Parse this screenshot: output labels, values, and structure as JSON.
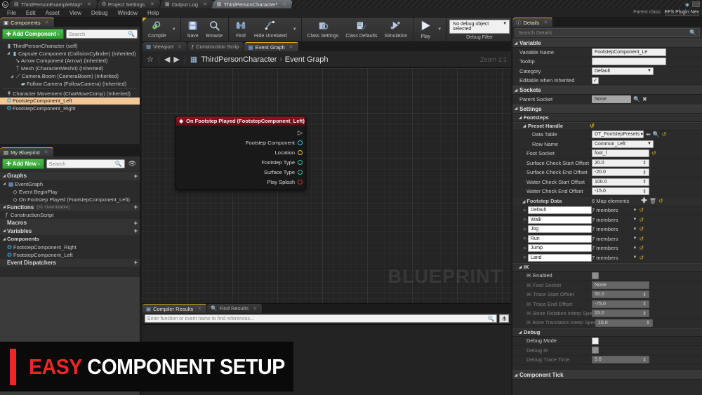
{
  "window": {
    "logo_icon": "unreal-logo-icon",
    "tabs": [
      {
        "label": "ThirdPersonExampleMap*",
        "icon": "map-icon",
        "active": false
      },
      {
        "label": "Project Settings",
        "icon": "settings-icon",
        "active": false
      },
      {
        "label": "Output Log",
        "icon": "log-icon",
        "active": false
      },
      {
        "label": "ThirdPersonCharacter*",
        "icon": "blueprint-icon",
        "active": true
      }
    ],
    "controls": {
      "gem_icon": "gem-icon",
      "minimize": "minimize-button"
    }
  },
  "menubar": {
    "items": [
      "File",
      "Edit",
      "Asset",
      "View",
      "Debug",
      "Window",
      "Help"
    ]
  },
  "parent_class": {
    "label": "Parent class:",
    "value": "EFS Plugin Nev"
  },
  "toolbar": {
    "groups": [
      {
        "buttons": [
          {
            "label": "Compile",
            "icon": "compile-gear-check-icon",
            "caret": true
          }
        ]
      },
      {
        "buttons": [
          {
            "label": "Save",
            "icon": "floppy-save-icon",
            "caret": false
          },
          {
            "label": "Browse",
            "icon": "magnifier-browse-icon",
            "caret": false
          }
        ]
      },
      {
        "buttons": [
          {
            "label": "Find",
            "icon": "binoculars-find-icon",
            "caret": false
          },
          {
            "label": "Hide Unrelated",
            "icon": "node-graph-icon",
            "caret": true
          }
        ]
      },
      {
        "buttons": [
          {
            "label": "Class Settings",
            "icon": "class-settings-gear-icon",
            "caret": false
          },
          {
            "label": "Class Defaults",
            "icon": "class-defaults-icon",
            "caret": false
          },
          {
            "label": "Simulation",
            "icon": "simulation-icon",
            "caret": false
          }
        ]
      },
      {
        "buttons": [
          {
            "label": "Play",
            "icon": "play-triangle-icon",
            "caret": true
          }
        ]
      }
    ],
    "debug": {
      "combo_value": "No debug object selected",
      "filter_label": "Debug Filter"
    }
  },
  "components_panel": {
    "tab_label": "Components",
    "tab_icon": "components-icon",
    "add_button": "Add Component",
    "add_button_caret": "-",
    "search_placeholder": "Search",
    "search_icon": "search-icon",
    "tree": [
      {
        "label": "ThirdPersonCharacter (self)",
        "indent": 0,
        "arrow": "",
        "icon": "actor-icon",
        "selected": false
      },
      {
        "label": "Capsule Component (CollisionCylinder) (Inherited)",
        "indent": 1,
        "arrow": "▾",
        "icon": "capsule-icon",
        "selected": false
      },
      {
        "label": "Arrow Component (Arrow) (Inherited)",
        "indent": 2,
        "arrow": "",
        "icon": "arrow-icon",
        "selected": false
      },
      {
        "label": "Mesh (CharacterMesh0) (Inherited)",
        "indent": 2,
        "arrow": "",
        "icon": "mesh-icon",
        "selected": false
      },
      {
        "label": "Camera Boom (CameraBoom) (Inherited)",
        "indent": 2,
        "arrow": "▾",
        "icon": "boom-icon",
        "selected": false
      },
      {
        "label": "Follow Camera (FollowCamera) (Inherited)",
        "indent": 3,
        "arrow": "",
        "icon": "camera-icon",
        "selected": false
      },
      {
        "label": "Character Movement (CharMoveComp) (Inherited)",
        "indent": 1,
        "arrow": "",
        "icon": "movement-icon",
        "selected": false
      },
      {
        "label": "FootstepComponent_Left",
        "indent": 1,
        "arrow": "",
        "icon": "footstep-component-icon",
        "selected": true
      },
      {
        "label": "FootstepComponent_Right",
        "indent": 1,
        "arrow": "",
        "icon": "footstep-component-icon",
        "selected": false
      }
    ]
  },
  "myblueprint_panel": {
    "tab_label": "My Blueprint",
    "tab_icon": "blueprint-book-icon",
    "add_button": "Add New",
    "add_button_caret": "-",
    "search_placeholder": "Search",
    "search_icon": "search-icon",
    "eye_icon": "eye-icon",
    "sections": [
      {
        "type": "category",
        "label": "Graphs",
        "sub": "",
        "plus": "+"
      },
      {
        "type": "item",
        "label": "EventGraph",
        "indent": 1,
        "arrow": "▾",
        "icon": "graph-icon"
      },
      {
        "type": "item",
        "label": "Event BeginPlay",
        "indent": 2,
        "arrow": "",
        "icon": "event-node-icon"
      },
      {
        "type": "item",
        "label": "On Footstep Played (FootstepComponent_Left)",
        "indent": 2,
        "arrow": "",
        "icon": "event-node-icon"
      },
      {
        "type": "category",
        "label": "Functions",
        "sub": "(31 Overridable)",
        "plus": "+"
      },
      {
        "type": "item",
        "label": "ConstructionScript",
        "indent": 1,
        "arrow": "",
        "icon": "function-icon"
      },
      {
        "type": "category",
        "label": "Macros",
        "sub": "",
        "plus": "+",
        "collapsed": true
      },
      {
        "type": "category",
        "label": "Variables",
        "sub": "",
        "plus": "+"
      },
      {
        "type": "category",
        "label": "Components",
        "sub": "",
        "plus": ""
      },
      {
        "type": "item",
        "label": "FootstepComponent_Right",
        "indent": 1,
        "arrow": "",
        "icon": "footstep-component-icon"
      },
      {
        "type": "item",
        "label": "FootstepComponent_Left",
        "indent": 1,
        "arrow": "",
        "icon": "footstep-component-icon"
      },
      {
        "type": "category",
        "label": "Event Dispatchers",
        "sub": "",
        "plus": "+",
        "collapsed": true
      }
    ]
  },
  "graph_panel": {
    "tabs": [
      {
        "label": "Viewport",
        "icon": "viewport-icon",
        "active": false
      },
      {
        "label": "Construction Scrip",
        "icon": "function-f-icon",
        "active": false
      },
      {
        "label": "Event Graph",
        "icon": "graph-icon",
        "active": true
      }
    ],
    "favorite_icon": "star-icon",
    "back_icon": "back-arrow-icon",
    "forward_icon": "forward-arrow-icon",
    "breadcrumb_icon": "graph-icon",
    "breadcrumb_root": "ThirdPersonCharacter",
    "breadcrumb_sep": "›",
    "breadcrumb_leaf": "Event Graph",
    "zoom_label": "Zoom 1:1",
    "watermark": "BLUEPRINT",
    "node": {
      "title": "On Footstep Played (FootstepComponent_Left)",
      "title_icon": "event-diamond-icon",
      "collapse_icon": "node-toggle-icon",
      "pins": [
        {
          "label": "",
          "type": "exec",
          "color": "#d8d8d8"
        },
        {
          "label": "Footstep Component",
          "type": "object",
          "color": "#35c3e8"
        },
        {
          "label": "Location",
          "type": "struct",
          "color": "#e8c030"
        },
        {
          "label": "Footstep Type",
          "type": "enum",
          "color": "#3fbfa8"
        },
        {
          "label": "Surface Type",
          "type": "enum",
          "color": "#3fbfa8"
        },
        {
          "label": "Play Splash",
          "type": "bool",
          "color": "#c33030"
        }
      ]
    }
  },
  "results_panel": {
    "tabs": [
      {
        "label": "Compiler Results",
        "icon": "compiler-results-icon",
        "active": true
      },
      {
        "label": "Find Results",
        "icon": "find-results-icon",
        "active": false
      }
    ],
    "find_placeholder": "Enter function or event name to find references...",
    "search_icon": "search-icon",
    "find_button_icon": "find-all-icon"
  },
  "details_panel": {
    "tab_label": "Details",
    "tab_icon": "details-icon",
    "search_placeholder": "Search Details",
    "search_icon": "search-icon",
    "sections": [
      {
        "name": "Variable",
        "level": 0,
        "rows": [
          {
            "name": "Variable Name",
            "indent": 2,
            "control": "text",
            "value": "FootstepComponent_Le"
          },
          {
            "name": "Tooltip",
            "indent": 2,
            "control": "text",
            "value": ""
          },
          {
            "name": "Category",
            "indent": 2,
            "control": "combo",
            "value": "Default"
          },
          {
            "name": "Editable when Inherited",
            "indent": 2,
            "control": "checkbox",
            "value": "checked"
          }
        ]
      },
      {
        "name": "Sockets",
        "level": 0,
        "rows": [
          {
            "name": "Parent Socket",
            "indent": 2,
            "control": "text-gray",
            "value": "None",
            "icons": [
              "search-icon",
              "clear-x-icon"
            ]
          }
        ]
      },
      {
        "name": "Settings",
        "level": 0,
        "rows": []
      },
      {
        "name": "Footsteps",
        "level": 1,
        "rows": []
      },
      {
        "name": "Preset Handle",
        "level": 2,
        "header_icons": [
          "reset-arrow-icon"
        ],
        "rows": [
          {
            "name": "Data Table",
            "indent": 3,
            "control": "combo",
            "value": "DT_FootstepPresets",
            "icons": [
              "use-selected-icon",
              "browse-icon",
              "reset-arrow-icon"
            ]
          },
          {
            "name": "Row Name",
            "indent": 3,
            "control": "combo-wide",
            "value": "Common_Left"
          },
          {
            "name": "Foot Socket",
            "indent": 2,
            "control": "text",
            "value": "foot_l",
            "icons": [
              "reset-arrow-icon"
            ]
          },
          {
            "name": "Surface Check Start Offset",
            "indent": 2,
            "control": "num",
            "value": "20.0"
          },
          {
            "name": "Surface Check End Offset",
            "indent": 2,
            "control": "num",
            "value": "-20.0"
          },
          {
            "name": "Water Check Start Offset",
            "indent": 2,
            "control": "num",
            "value": "100.0"
          },
          {
            "name": "Water Check End Offset",
            "indent": 2,
            "control": "num",
            "value": "-15.0"
          }
        ]
      },
      {
        "name": "Footstep Data",
        "level": 2,
        "summary": "6 Map elements",
        "summary_icons": [
          "add-element-icon",
          "delete-icon",
          "reset-arrow-icon"
        ],
        "map_rows": [
          {
            "key": "Default",
            "value": "7 members"
          },
          {
            "key": "Walk",
            "value": "7 members"
          },
          {
            "key": "Jog",
            "value": "7 members"
          },
          {
            "key": "Run",
            "value": "7 members"
          },
          {
            "key": "Jump",
            "value": "7 members"
          },
          {
            "key": "Land",
            "value": "7 members"
          }
        ]
      },
      {
        "name": "IK",
        "level": 1,
        "rows": [
          {
            "name": "IK Enabled",
            "indent": 2,
            "control": "checkbox-gray",
            "value": ""
          },
          {
            "name": "IK Foot Socket",
            "indent": 2,
            "control": "text-dark",
            "value": "None",
            "dim": true
          },
          {
            "name": "IK Trace Start Offset",
            "indent": 2,
            "control": "num-dark",
            "value": "50.0",
            "dim": true
          },
          {
            "name": "IK Trace End Offset",
            "indent": 2,
            "control": "num-dark",
            "value": "-75.0",
            "dim": true
          },
          {
            "name": "IK Bone Rotation Interp Speed",
            "indent": 2,
            "control": "num-dark",
            "value": "15.0",
            "dim": true
          },
          {
            "name": "IK Bone Translation Interp Speed",
            "indent": 2,
            "control": "num-dark",
            "value": "15.0",
            "dim": true
          }
        ]
      },
      {
        "name": "Debug",
        "level": 1,
        "rows": [
          {
            "name": "Debug Mode",
            "indent": 2,
            "control": "checkbox-empty",
            "value": ""
          },
          {
            "name": "Debug IK",
            "indent": 2,
            "control": "checkbox-gray",
            "value": "",
            "dim": true
          },
          {
            "name": "Debug Trace Time",
            "indent": 2,
            "control": "num-dark",
            "value": "5.0",
            "dim": true
          }
        ]
      },
      {
        "name": "Component Tick",
        "level": 0,
        "rows": []
      }
    ]
  },
  "banner": {
    "word1": "EASY",
    "word2": "COMPONENT SETUP",
    "accent_color": "#ee2626"
  }
}
